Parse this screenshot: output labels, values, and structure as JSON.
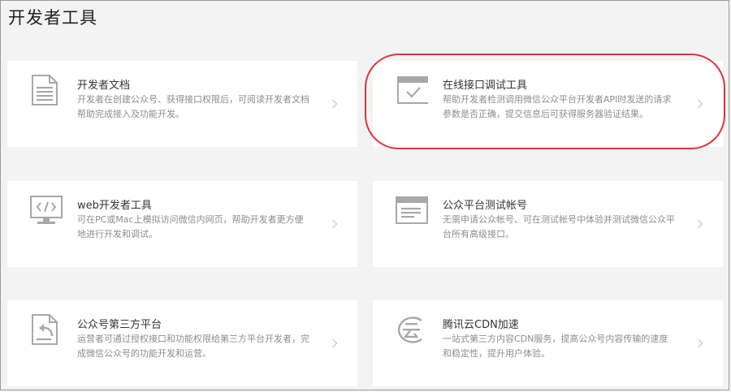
{
  "page": {
    "title": "开发者工具"
  },
  "colors": {
    "highlight": "#e0353a",
    "icon": "#a8a8a8",
    "description": "#8d8d8d"
  },
  "cards": [
    {
      "title": "开发者文档",
      "icon": "document-icon",
      "desc1": "开发者在创建公众号、获得接口权限后，可阅读开发者文档",
      "desc2": "帮助完成接入及功能开发。"
    },
    {
      "title": "在线接口调试工具",
      "icon": "browser-check-icon",
      "desc1": "帮助开发者检测调用微信公众平台开发者API时发送的请求",
      "desc2": "参数是否正确，提交信息后可获得服务器验证结果。"
    },
    {
      "title": "web开发者工具",
      "icon": "code-monitor-icon",
      "desc1": "可在PC或Mac上模拟访问微信内网页，帮助开发者更方便",
      "desc2": "地进行开发和调试。"
    },
    {
      "title": "公众平台测试帐号",
      "icon": "browser-window-icon",
      "desc1": "无需申请公众帐号、可在测试帐号中体验并测试微信公众平",
      "desc2": "台所有高级接口。"
    },
    {
      "title": "公众号第三方平台",
      "icon": "document-return-icon",
      "desc1": "运营者可通过授权接口和功能权限给第三方平台开发者，完",
      "desc2": "成微信公众号的功能开发和运营。"
    },
    {
      "title": "腾讯云CDN加速",
      "icon": "tencent-cloud-icon",
      "desc1": "一站式第三方内容CDN服务，提高公众号内容传输的速度",
      "desc2": "和稳定性，提升用户体验。"
    }
  ]
}
